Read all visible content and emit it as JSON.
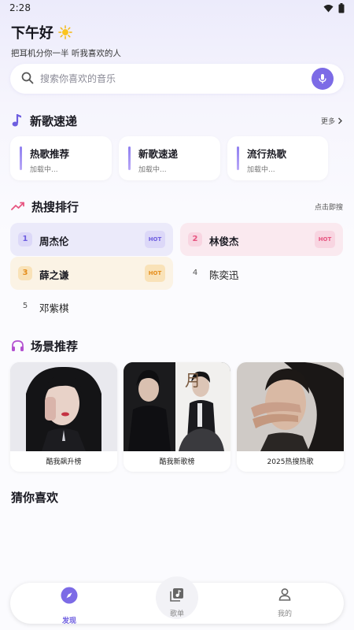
{
  "status_bar": {
    "time": "2:28"
  },
  "greeting": {
    "title": "下午好",
    "subtitle": "把耳机分你一半 听我喜欢的人"
  },
  "search": {
    "placeholder": "搜索你喜欢的音乐"
  },
  "new_songs": {
    "title": "新歌速递",
    "more_label": "更多",
    "cards": [
      {
        "title": "热歌推荐",
        "status": "加载中..."
      },
      {
        "title": "新歌速递",
        "status": "加载中..."
      },
      {
        "title": "流行热歌",
        "status": "加载中..."
      }
    ]
  },
  "hot_search": {
    "title": "热搜排行",
    "action_label": "点击即搜",
    "items": [
      {
        "rank": "1",
        "name": "周杰伦",
        "badge": "HOT"
      },
      {
        "rank": "2",
        "name": "林俊杰",
        "badge": "HOT"
      },
      {
        "rank": "3",
        "name": "薛之谦",
        "badge": "HOT"
      },
      {
        "rank": "4",
        "name": "陈奕迅"
      },
      {
        "rank": "5",
        "name": "邓紫棋"
      }
    ]
  },
  "scenes": {
    "title": "场景推荐",
    "items": [
      {
        "label": "酷我飙升榜"
      },
      {
        "label": "酷我新歌榜"
      },
      {
        "label": "2025热搜热歌"
      }
    ]
  },
  "guess": {
    "title": "猜你喜欢"
  },
  "bottom_nav": {
    "items": [
      {
        "label": "发现",
        "icon": "compass-icon",
        "active": true
      },
      {
        "label": "歌单",
        "icon": "playlist-icon",
        "active": false
      },
      {
        "label": "我的",
        "icon": "person-icon",
        "active": false
      }
    ]
  },
  "colors": {
    "accent": "#7c6be6",
    "hot_pink": "#e75480",
    "warm": "#f2a43a"
  }
}
